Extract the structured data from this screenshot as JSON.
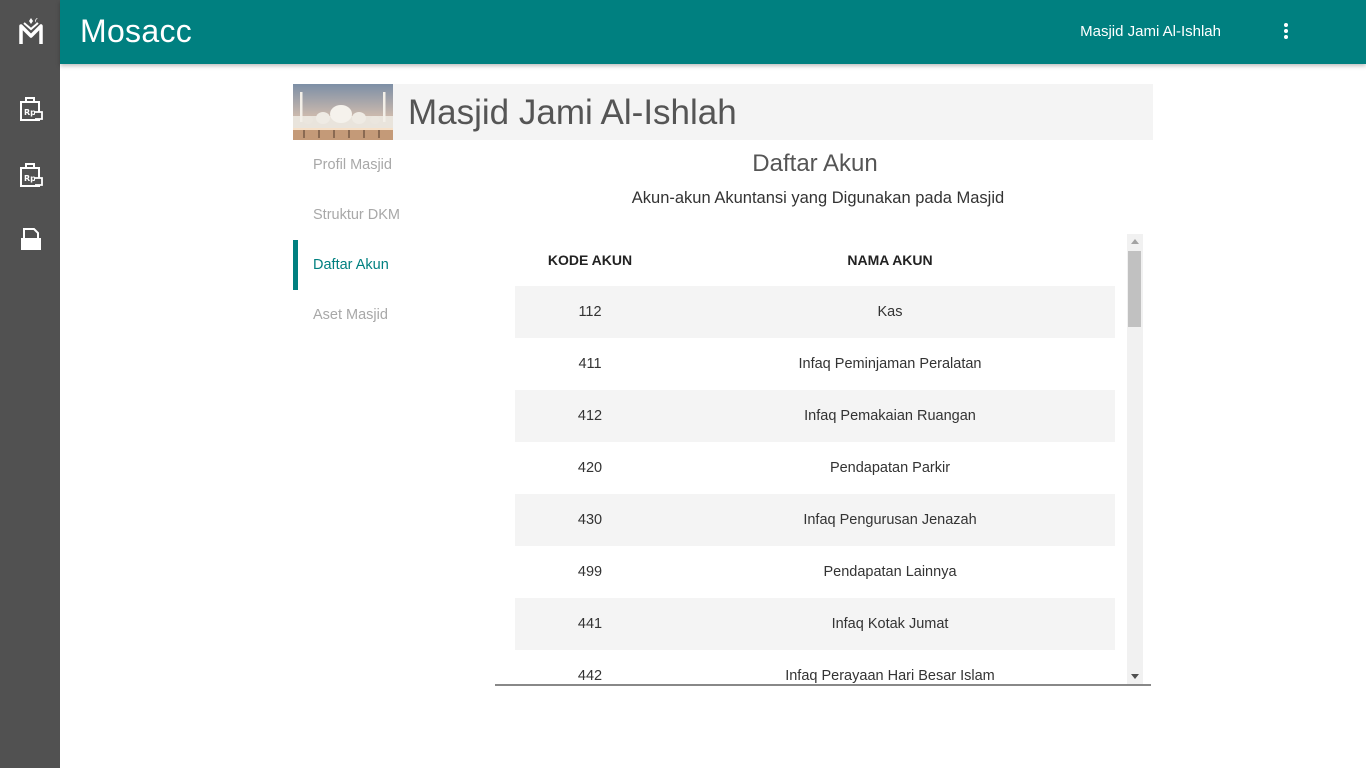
{
  "app": {
    "title": "Mosacc",
    "account_name": "Masjid Jami Al-Ishlah"
  },
  "rail": {
    "icons": [
      "logo-icon",
      "finance-report-icon",
      "finance-report-icon",
      "print-icon"
    ]
  },
  "masjid": {
    "name": "Masjid Jami Al-Ishlah"
  },
  "side_tabs": [
    {
      "label": "Profil Masjid",
      "active": false
    },
    {
      "label": "Struktur DKM",
      "active": false
    },
    {
      "label": "Daftar Akun",
      "active": true
    },
    {
      "label": "Aset Masjid",
      "active": false
    }
  ],
  "content": {
    "title": "Daftar Akun",
    "subtitle": "Akun-akun Akuntansi yang Digunakan pada Masjid"
  },
  "table": {
    "headers": [
      "KODE AKUN",
      "NAMA AKUN"
    ],
    "rows": [
      [
        "112",
        "Kas"
      ],
      [
        "411",
        "Infaq Peminjaman Peralatan"
      ],
      [
        "412",
        "Infaq Pemakaian Ruangan"
      ],
      [
        "420",
        "Pendapatan Parkir"
      ],
      [
        "430",
        "Infaq Pengurusan Jenazah"
      ],
      [
        "499",
        "Pendapatan Lainnya"
      ],
      [
        "441",
        "Infaq Kotak Jumat"
      ],
      [
        "442",
        "Infaq Perayaan Hari Besar Islam"
      ]
    ]
  },
  "colors": {
    "primary": "#008080",
    "rail": "#515151",
    "stripe": "#f4f4f4"
  }
}
